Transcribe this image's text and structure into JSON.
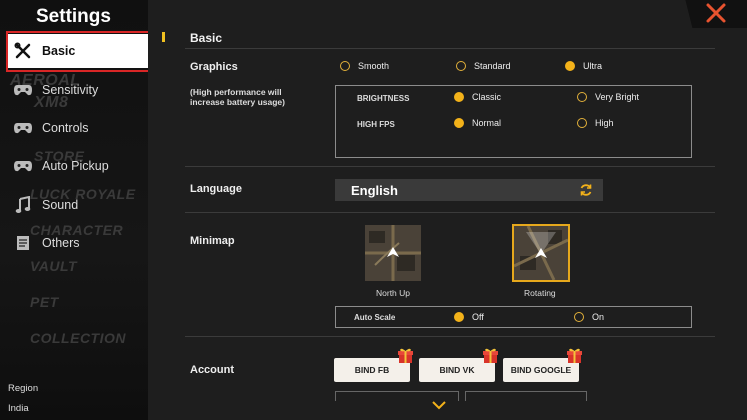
{
  "sidebar": {
    "title": "Settings",
    "items": [
      {
        "label": "Basic",
        "icon": "wrench-screwdriver-icon",
        "active": true
      },
      {
        "label": "Sensitivity",
        "icon": "gamepad-icon",
        "active": false
      },
      {
        "label": "Controls",
        "icon": "gamepad-icon",
        "active": false
      },
      {
        "label": "Auto Pickup",
        "icon": "gamepad-icon",
        "active": false
      },
      {
        "label": "Sound",
        "icon": "music-note-icon",
        "active": false
      },
      {
        "label": "Others",
        "icon": "document-icon",
        "active": false
      }
    ],
    "background_text": [
      "AEROAL",
      "XM8",
      "STORE",
      "LUCK ROYALE",
      "CHARACTER",
      "VAULT",
      "PET",
      "COLLECTION"
    ],
    "region_label": "Region",
    "region_value": "India"
  },
  "main": {
    "section_title": "Basic",
    "graphics": {
      "label": "Graphics",
      "note_line1": "(High performance will",
      "note_line2": "increase battery usage)",
      "options": [
        {
          "label": "Smooth",
          "selected": false
        },
        {
          "label": "Standard",
          "selected": false
        },
        {
          "label": "Ultra",
          "selected": true
        }
      ],
      "brightness": {
        "label": "BRIGHTNESS",
        "options": [
          {
            "label": "Classic",
            "selected": true
          },
          {
            "label": "Very Bright",
            "selected": false
          }
        ]
      },
      "high_fps": {
        "label": "HIGH FPS",
        "options": [
          {
            "label": "Normal",
            "selected": true
          },
          {
            "label": "High",
            "selected": false
          }
        ]
      }
    },
    "language": {
      "label": "Language",
      "value": "English"
    },
    "minimap": {
      "label": "Minimap",
      "options": [
        {
          "label": "North Up",
          "selected": false
        },
        {
          "label": "Rotating",
          "selected": true
        }
      ],
      "auto_scale": {
        "label": "Auto Scale",
        "options": [
          {
            "label": "Off",
            "selected": true
          },
          {
            "label": "On",
            "selected": false
          }
        ]
      }
    },
    "account": {
      "label": "Account",
      "buttons": [
        "BIND FB",
        "BIND VK",
        "BIND GOOGLE"
      ]
    }
  },
  "colors": {
    "accent": "#f3b21a",
    "close": "#e8532f",
    "highlight_box": "#d92626"
  }
}
